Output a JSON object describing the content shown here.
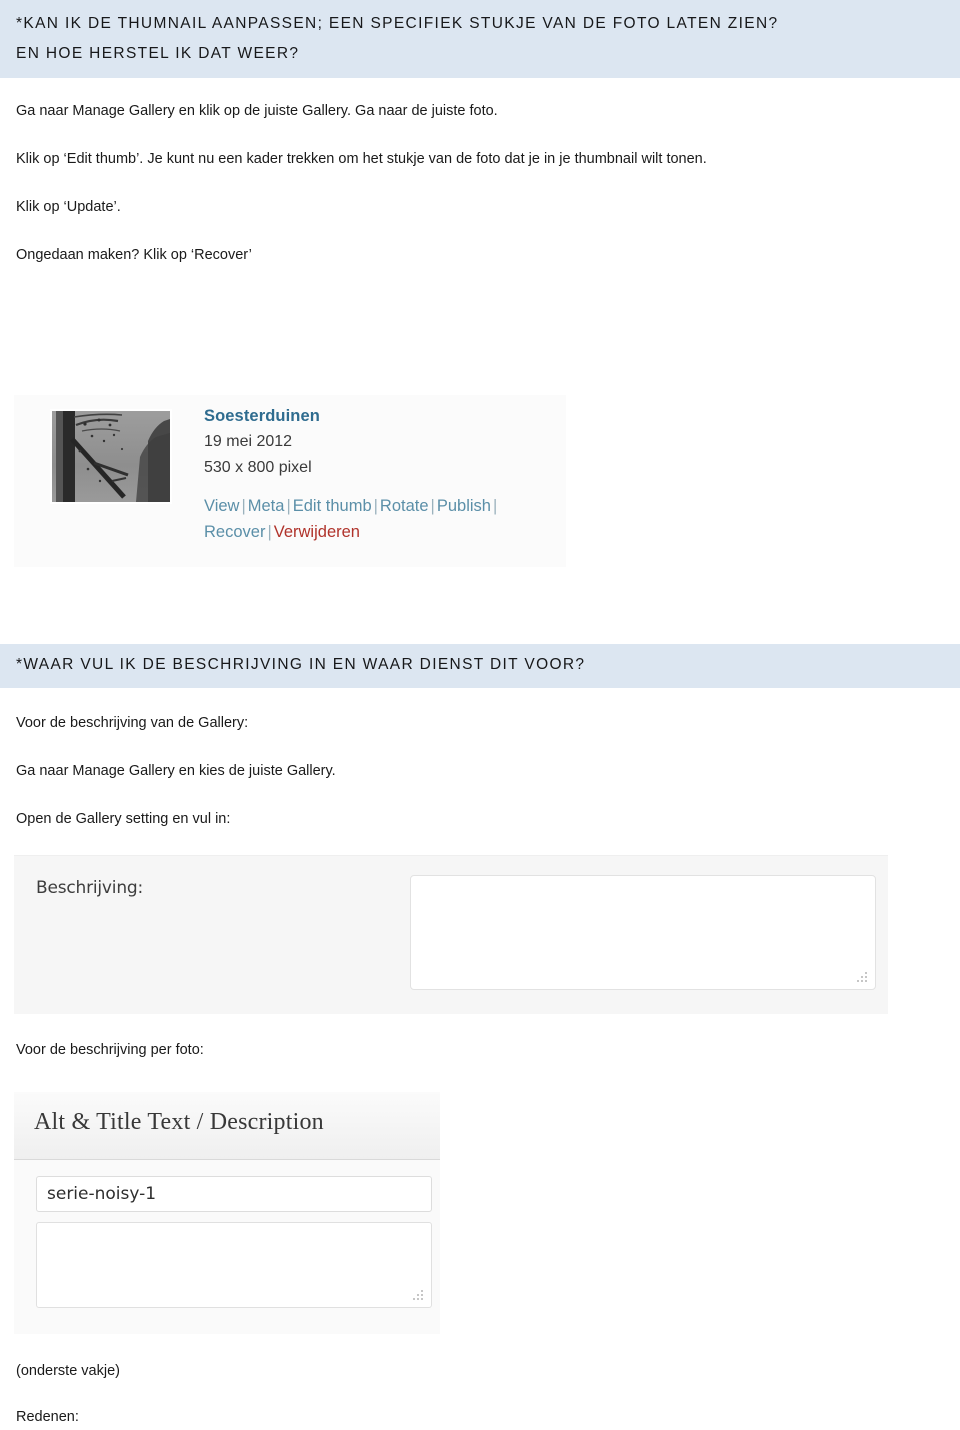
{
  "document": {
    "sections": [
      {
        "id": "thumbnail",
        "heading_lines": [
          "*KAN IK DE THUMNAIL AANPASSEN; EEN SPECIFIEK STUKJE VAN DE FOTO LATEN ZIEN?",
          "EN HOE HERSTEL IK DAT WEER?"
        ],
        "paragraphs": [
          "Ga naar Manage Gallery en klik op de juiste Gallery. Ga naar de juiste foto.",
          "Klik op ‘Edit thumb’. Je kunt nu een kader trekken om het stukje van de foto dat je in je thumbnail wilt tonen.",
          "Klik op ‘Update’.",
          "Ongedaan maken? Klik op ‘Recover’"
        ]
      },
      {
        "id": "beschrijving",
        "heading_lines": [
          "*WAAR VUL IK DE BESCHRIJVING IN EN WAAR DIENST DIT VOOR?"
        ],
        "paragraphs": [
          "Voor de beschrijving van de Gallery:",
          "Ga naar Manage Gallery en kies de juiste Gallery.",
          "Open de Gallery setting en vul in:"
        ]
      }
    ],
    "caption_per_foto": "Voor de beschrijving per foto:",
    "footer_lines": [
      "(onderste vakje)",
      "Redenen:"
    ]
  },
  "gallery_shot": {
    "title": "Soesterduinen",
    "date": "19 mei 2012",
    "dimensions": "530 x 800 pixel",
    "thumbnail_alt": "grayscale-photo-of-bare-trees-against-sky",
    "links_row1": [
      "View",
      "Meta",
      "Edit thumb",
      "Rotate",
      "Publish"
    ],
    "links_row2": [
      "Recover",
      "Verwijderen"
    ],
    "separator": "|",
    "link_color": "#5b8fa8",
    "danger_color": "#b0332b",
    "title_color": "#2f6c8f"
  },
  "beschrijving_shot": {
    "label": "Beschrijving:",
    "textarea_value": "",
    "textarea_placeholder": "",
    "resize_grip": "resize-grip-icon"
  },
  "alt_title_shot": {
    "panel_heading": "Alt & Title Text / Description",
    "title_field_value": "serie-noisy-1",
    "description_field_value": "",
    "resize_grip": "resize-grip-icon"
  },
  "theme": {
    "band_background": "#dce6f1",
    "page_background": "#ffffff",
    "text_color": "#1a1a1a"
  }
}
